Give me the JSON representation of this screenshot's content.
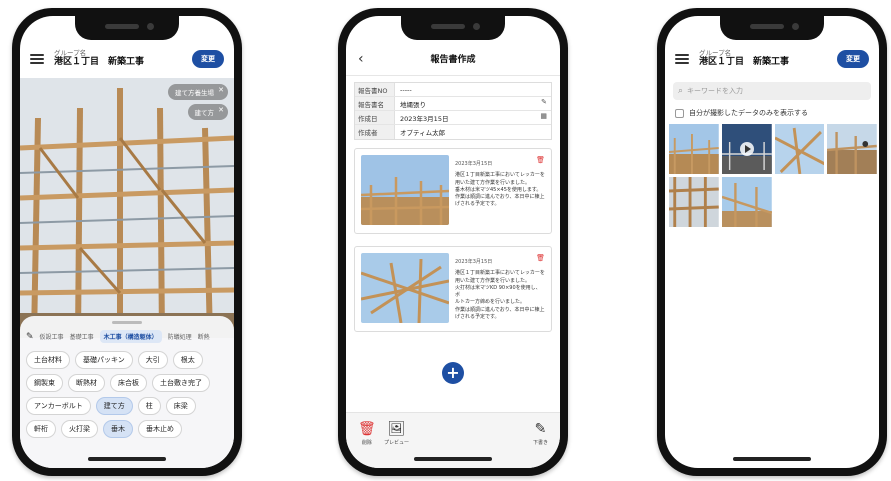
{
  "phone1": {
    "group_label": "グループ名",
    "group_name": "港区１丁目　新築工事",
    "change_button": "変更",
    "photo_tags": [
      {
        "label": "建て方養生場"
      },
      {
        "label": "建て方"
      }
    ],
    "category_tabs": [
      {
        "label": "仮設工事",
        "active": false
      },
      {
        "label": "基礎工事",
        "active": false
      },
      {
        "label": "木工事（構造躯体）",
        "active": true
      },
      {
        "label": "防蟻処理",
        "active": false
      },
      {
        "label": "断熱",
        "active": false
      }
    ],
    "chips": [
      {
        "label": "土台材料",
        "selected": false
      },
      {
        "label": "基礎パッキン",
        "selected": false
      },
      {
        "label": "大引",
        "selected": false
      },
      {
        "label": "根太",
        "selected": false
      },
      {
        "label": "鋼製束",
        "selected": false
      },
      {
        "label": "断熱材",
        "selected": false
      },
      {
        "label": "床合板",
        "selected": false
      },
      {
        "label": "土台敷き完了",
        "selected": false
      },
      {
        "label": "アンカーボルト",
        "selected": false
      },
      {
        "label": "建て方",
        "selected": true
      },
      {
        "label": "柱",
        "selected": false
      },
      {
        "label": "床梁",
        "selected": false
      },
      {
        "label": "軒桁",
        "selected": false
      },
      {
        "label": "火打梁",
        "selected": false
      },
      {
        "label": "垂木",
        "selected": true
      },
      {
        "label": "垂木止め",
        "selected": false
      }
    ]
  },
  "phone2": {
    "title": "報告書作成",
    "fields": [
      {
        "key": "報告書NO",
        "value": "-----",
        "icon": ""
      },
      {
        "key": "報告書名",
        "value": "地縄張り",
        "icon": "pencil-icon"
      },
      {
        "key": "作成日",
        "value": "2023年3月15日",
        "icon": "calendar-icon"
      },
      {
        "key": "作成者",
        "value": "オプティム太郎",
        "icon": ""
      }
    ],
    "cards": [
      {
        "date": "2023年3月15日",
        "lines": [
          "港区１丁目新築工事においてレッカーを",
          "用いた建て方作業を行いました。",
          "垂木材は米マツ45×45を使用します。",
          "作業は順調に進んでおり、本日中に棟上",
          "げされる予定です。"
        ]
      },
      {
        "date": "2023年3月15日",
        "lines": [
          "港区１丁目新築工事においてレッカーを",
          "用いた建て方作業を行いました。",
          "火打材は米マツKD 90×90を使用し、ボ",
          "ルトカー方締めを行いました。",
          "作業は順調に進んでおり、本日中に棟上",
          "げされる予定です。"
        ]
      }
    ],
    "bottom": {
      "delete_label": "削除",
      "preview_label": "プレビュー",
      "draft_label": "下書き"
    }
  },
  "phone3": {
    "group_label": "グループ名",
    "group_name": "港区１丁目　新築工事",
    "change_button": "変更",
    "search_placeholder": "キーワードを入力",
    "own_data_label": "自分が撮影したデータのみを表示する"
  }
}
